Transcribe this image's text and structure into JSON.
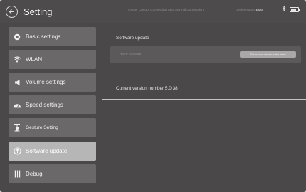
{
  "header": {
    "title": "Setting",
    "status_text": "Center Control Connecting Seta:Normal Connection",
    "device_status_prefix": "Device status:",
    "device_status_value": "Busy",
    "icons": [
      "back-arrow-icon",
      "bluetooth-icon",
      "battery-icon"
    ]
  },
  "sidebar": {
    "items": [
      {
        "label": "Basic settings",
        "icon": "settings-dot-icon",
        "active": false
      },
      {
        "label": "WLAN",
        "icon": "wifi-icon",
        "active": false
      },
      {
        "label": "Volume settings",
        "icon": "speaker-icon",
        "active": false
      },
      {
        "label": "Speed settings",
        "icon": "speedometer-icon",
        "active": false
      },
      {
        "label": "Gesture Setting",
        "icon": "gesture-icon",
        "active": false
      },
      {
        "label": "Software update",
        "icon": "update-icon",
        "active": true
      },
      {
        "label": "Debug",
        "icon": "debug-icon",
        "active": false
      }
    ]
  },
  "main": {
    "section_title": "Software update",
    "check_label": "Check update",
    "check_status": "The current version is the latest",
    "version_text": "Current version number  5.0.38"
  },
  "colors": {
    "background": "#4a4848",
    "sidebar_item": "#6a6868",
    "sidebar_item_active": "#b6b6b6",
    "text": "#ececec",
    "divider": "#d9d9d9"
  }
}
